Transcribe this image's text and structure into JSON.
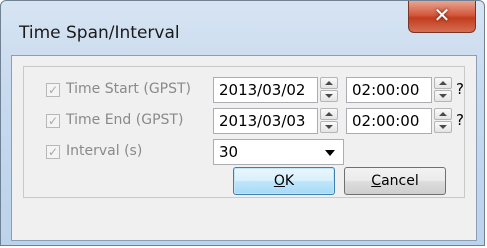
{
  "window": {
    "title": "Time Span/Interval",
    "close_glyph": "✕"
  },
  "fields": {
    "time_start": {
      "checkbox_glyph": "✓",
      "label": "Time Start (GPST)",
      "date": "2013/03/02",
      "time": "02:00:00",
      "help": "?"
    },
    "time_end": {
      "checkbox_glyph": "✓",
      "label": "Time End (GPST)",
      "date": "2013/03/03",
      "time": "02:00:00",
      "help": "?"
    },
    "interval": {
      "checkbox_glyph": "✓",
      "label": "Interval (s)",
      "value": "30"
    }
  },
  "buttons": {
    "ok": {
      "mnemonic": "O",
      "rest": "K"
    },
    "cancel": {
      "mnemonic": "C",
      "rest": "ancel"
    }
  },
  "icons": {
    "close": "close-icon",
    "spin_up": "chevron-up-icon",
    "spin_down": "chevron-down-icon",
    "dropdown": "dropdown-arrow-icon",
    "check": "check-icon"
  },
  "colors": {
    "title_bar": "#c6d9ee",
    "close_button": "#c23d1f",
    "dialog_background": "#f0f0f0",
    "disabled_text": "#8a8a8a",
    "default_button_border": "#3c7fb1"
  }
}
